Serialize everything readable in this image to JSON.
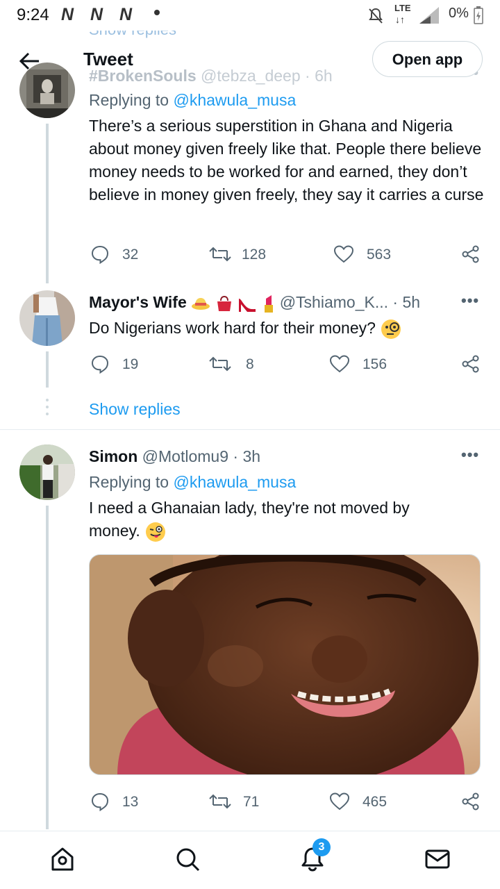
{
  "status_bar": {
    "time": "9:24",
    "network_icons": [
      "N",
      "N",
      "N"
    ],
    "lte": "LTE",
    "battery": "0%"
  },
  "header": {
    "title": "Tweet",
    "open_app": "Open app",
    "behind_text": "Show replies"
  },
  "tweets": [
    {
      "name": "#BrokenSouls",
      "handle": "@tebza_deep",
      "time": "· 6h",
      "replying_prefix": "Replying to",
      "replying_to": "@khawula_musa",
      "text": "There’s a serious superstition in Ghana and Nigeria about money given freely like that. People there believe money needs to be worked for and earned, they don’t believe in money given freely, they say it carries a curse",
      "replies": "32",
      "retweets": "128",
      "likes": "563"
    },
    {
      "name": "Mayor's Wife",
      "handle": "@Tshiamo_K...",
      "time": "· 5h",
      "text": "Do Nigerians work hard for their money?",
      "replies": "19",
      "retweets": "8",
      "likes": "156",
      "show_replies": "Show replies"
    },
    {
      "name": "Simon",
      "handle": "@Motlomu9",
      "time": "· 3h",
      "replying_prefix": "Replying to",
      "replying_to": "@khawula_musa",
      "text": "I need a Ghanaian lady, they're not moved by money.",
      "replies": "13",
      "retweets": "71",
      "likes": "465"
    }
  ],
  "bottom_nav": {
    "notifications_badge": "3",
    "items": [
      "home-icon",
      "search-icon",
      "bell-icon",
      "mail-icon"
    ]
  },
  "colors": {
    "accent": "#1d9bf0",
    "text": "#0f1419",
    "secondary": "#536471"
  }
}
